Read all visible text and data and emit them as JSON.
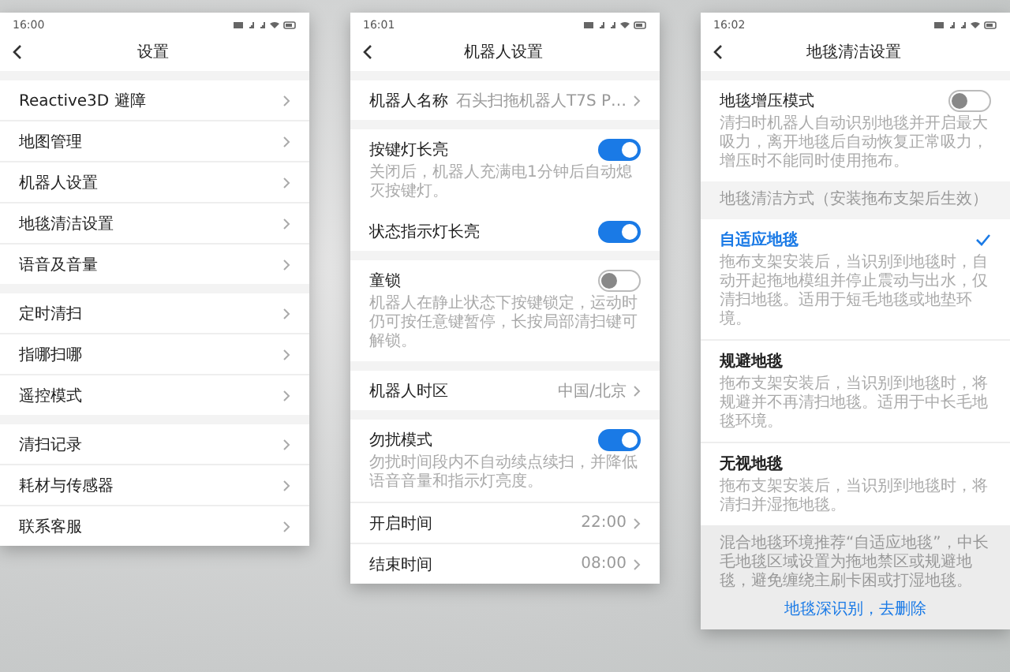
{
  "screens": [
    {
      "status_time": "16:00",
      "title": "设置",
      "groups": [
        {
          "items": [
            {
              "kind": "link",
              "label": "Reactive3D 避障"
            },
            {
              "kind": "link",
              "label": "地图管理"
            },
            {
              "kind": "link",
              "label": "机器人设置"
            },
            {
              "kind": "link",
              "label": "地毯清洁设置"
            },
            {
              "kind": "link",
              "label": "语音及音量"
            }
          ]
        },
        {
          "items": [
            {
              "kind": "link",
              "label": "定时清扫"
            },
            {
              "kind": "link",
              "label": "指哪扫哪"
            },
            {
              "kind": "link",
              "label": "遥控模式"
            }
          ]
        },
        {
          "items": [
            {
              "kind": "link",
              "label": "清扫记录"
            },
            {
              "kind": "link",
              "label": "耗材与传感器"
            },
            {
              "kind": "link",
              "label": "联系客服"
            }
          ]
        }
      ]
    },
    {
      "status_time": "16:01",
      "title": "机器人设置",
      "groups": [
        {
          "items": [
            {
              "kind": "link",
              "label": "机器人名称",
              "value": "石头扫拖机器人T7S P…"
            }
          ]
        },
        {
          "items": [
            {
              "kind": "toggle",
              "label": "按键灯长亮",
              "on": true,
              "description": "关闭后，机器人充满电1分钟后自动熄灭按键灯。"
            },
            {
              "kind": "toggle",
              "label": "状态指示灯长亮",
              "on": true
            }
          ]
        },
        {
          "items": [
            {
              "kind": "toggle",
              "label": "童锁",
              "on": false,
              "description": "机器人在静止状态下按键锁定，运动时仍可按任意键暂停，长按局部清扫键可解锁。"
            }
          ]
        },
        {
          "items": [
            {
              "kind": "link",
              "label": "机器人时区",
              "value": "中国/北京"
            }
          ]
        },
        {
          "items": [
            {
              "kind": "toggle",
              "label": "勿扰模式",
              "on": true,
              "description": "勿扰时间段内不自动续点续扫，并降低语音音量和指示灯亮度。"
            },
            {
              "kind": "link",
              "label": "开启时间",
              "value": "22:00"
            },
            {
              "kind": "link",
              "label": "结束时间",
              "value": "08:00"
            }
          ]
        }
      ]
    },
    {
      "status_time": "16:02",
      "title": "地毯清洁设置",
      "groups": [
        {
          "items": [
            {
              "kind": "toggle",
              "label": "地毯增压模式",
              "on": false,
              "description": "清扫时机器人自动识别地毯并开启最大吸力，离开地毯后自动恢复正常吸力，增压时不能同时使用拖布。"
            }
          ]
        },
        {
          "header": "地毯清洁方式（安装拖布支架后生效）",
          "items": [
            {
              "kind": "option",
              "label": "自适应地毯",
              "selected": true,
              "description": "拖布支架安装后，当识别到地毯时，自动开起拖地模组并停止震动与出水，仅清扫地毯。适用于短毛地毯或地垫环境。"
            },
            {
              "kind": "option",
              "label": "规避地毯",
              "selected": false,
              "description": "拖布支架安装后，当识别到地毯时，将规避并不再清扫地毯。适用于中长毛地毯环境。"
            },
            {
              "kind": "option",
              "label": "无视地毯",
              "selected": false,
              "description": "拖布支架安装后，当识别到地毯时，将清扫并湿拖地毯。"
            },
            {
              "kind": "note",
              "text": "混合地毯环境推荐“自适应地毯”，中长毛地毯区域设置为拖地禁区或规避地毯，避免缠绕主刷卡困或打湿地毯。",
              "link": "地毯深识别，去删除"
            }
          ]
        }
      ]
    }
  ]
}
